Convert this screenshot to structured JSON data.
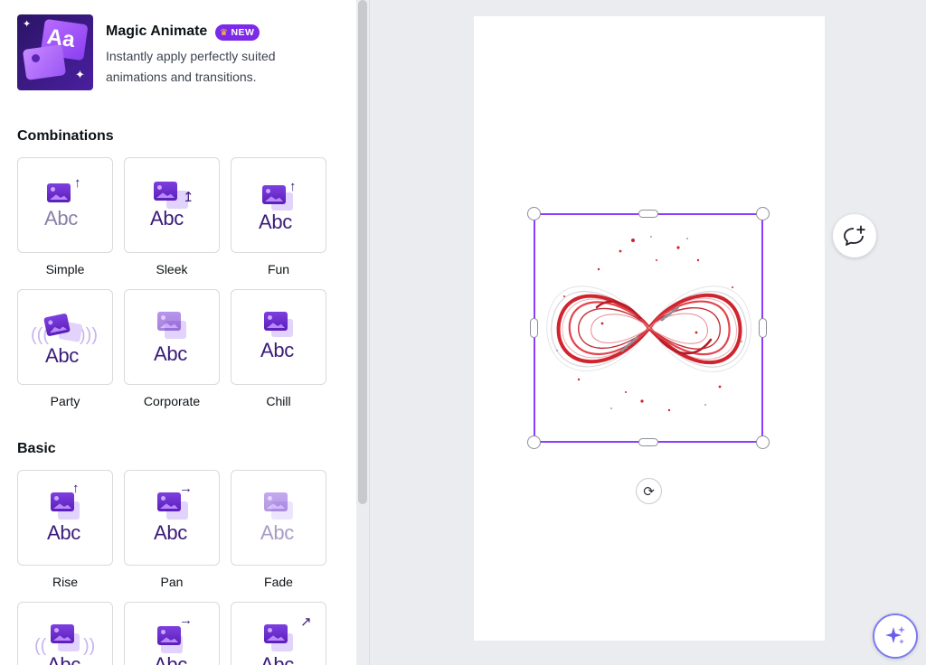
{
  "feature": {
    "title": "Magic Animate",
    "badge": "NEW",
    "description": "Instantly apply perfectly suited animations and transitions.",
    "thumb_text": "Aa"
  },
  "sections": {
    "combinations": {
      "title": "Combinations",
      "items": [
        "Simple",
        "Sleek",
        "Fun",
        "Party",
        "Corporate",
        "Chill"
      ]
    },
    "basic": {
      "title": "Basic",
      "items": [
        "Rise",
        "Pan",
        "Fade",
        "",
        "",
        ""
      ]
    }
  },
  "tile_text": "Abc",
  "colors": {
    "accent": "#7d2ae8",
    "selection": "#8b3dff",
    "icon_purple": "#5b1fb8",
    "art_red": "#d0242e"
  },
  "icons": {
    "comment": "add-comment-icon",
    "rotate": "rotate-icon",
    "magic": "sparkles-icon"
  }
}
